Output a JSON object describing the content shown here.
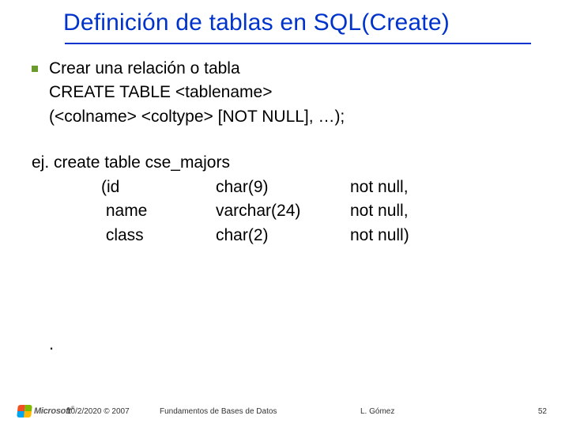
{
  "title": "Definición de tablas en  SQL(Create)",
  "bullet": {
    "l1": "Crear una relación o tabla",
    "l2": "CREATE TABLE <tablename>",
    "l3": "(<colname> <coltype> [NOT NULL], …);"
  },
  "example": {
    "intro": "ej. create table cse_majors",
    "rows": [
      {
        "a": "(id",
        "b": "char(9)",
        "c": "not null,"
      },
      {
        "a": " name",
        "b": "varchar(24)",
        "c": "not null,"
      },
      {
        "a": " class",
        "b": "char(2)",
        "c": "not null)"
      }
    ]
  },
  "lone_dot": ".",
  "footer": {
    "date": "10/2/2020 © 2007",
    "center": "Fundamentos de Bases de Datos",
    "author": "L. Gómez",
    "page": "52"
  },
  "logo": {
    "text": "Microsoft",
    "tm": "®"
  }
}
